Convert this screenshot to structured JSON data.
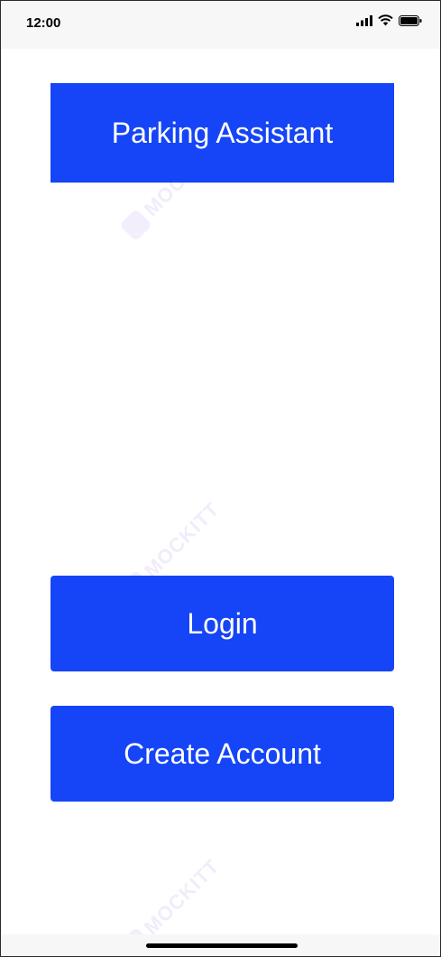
{
  "status_bar": {
    "time": "12:00",
    "icons": [
      "signal-icon",
      "wifi-icon",
      "battery-icon"
    ]
  },
  "header": {
    "title": "Parking Assistant"
  },
  "actions": {
    "login_label": "Login",
    "create_account_label": "Create Account"
  },
  "watermark": {
    "text": "MOCKITT"
  },
  "colors": {
    "primary": "#1545f6",
    "button_text": "#ffffff",
    "status_bar_bg": "#f7f7f7"
  }
}
